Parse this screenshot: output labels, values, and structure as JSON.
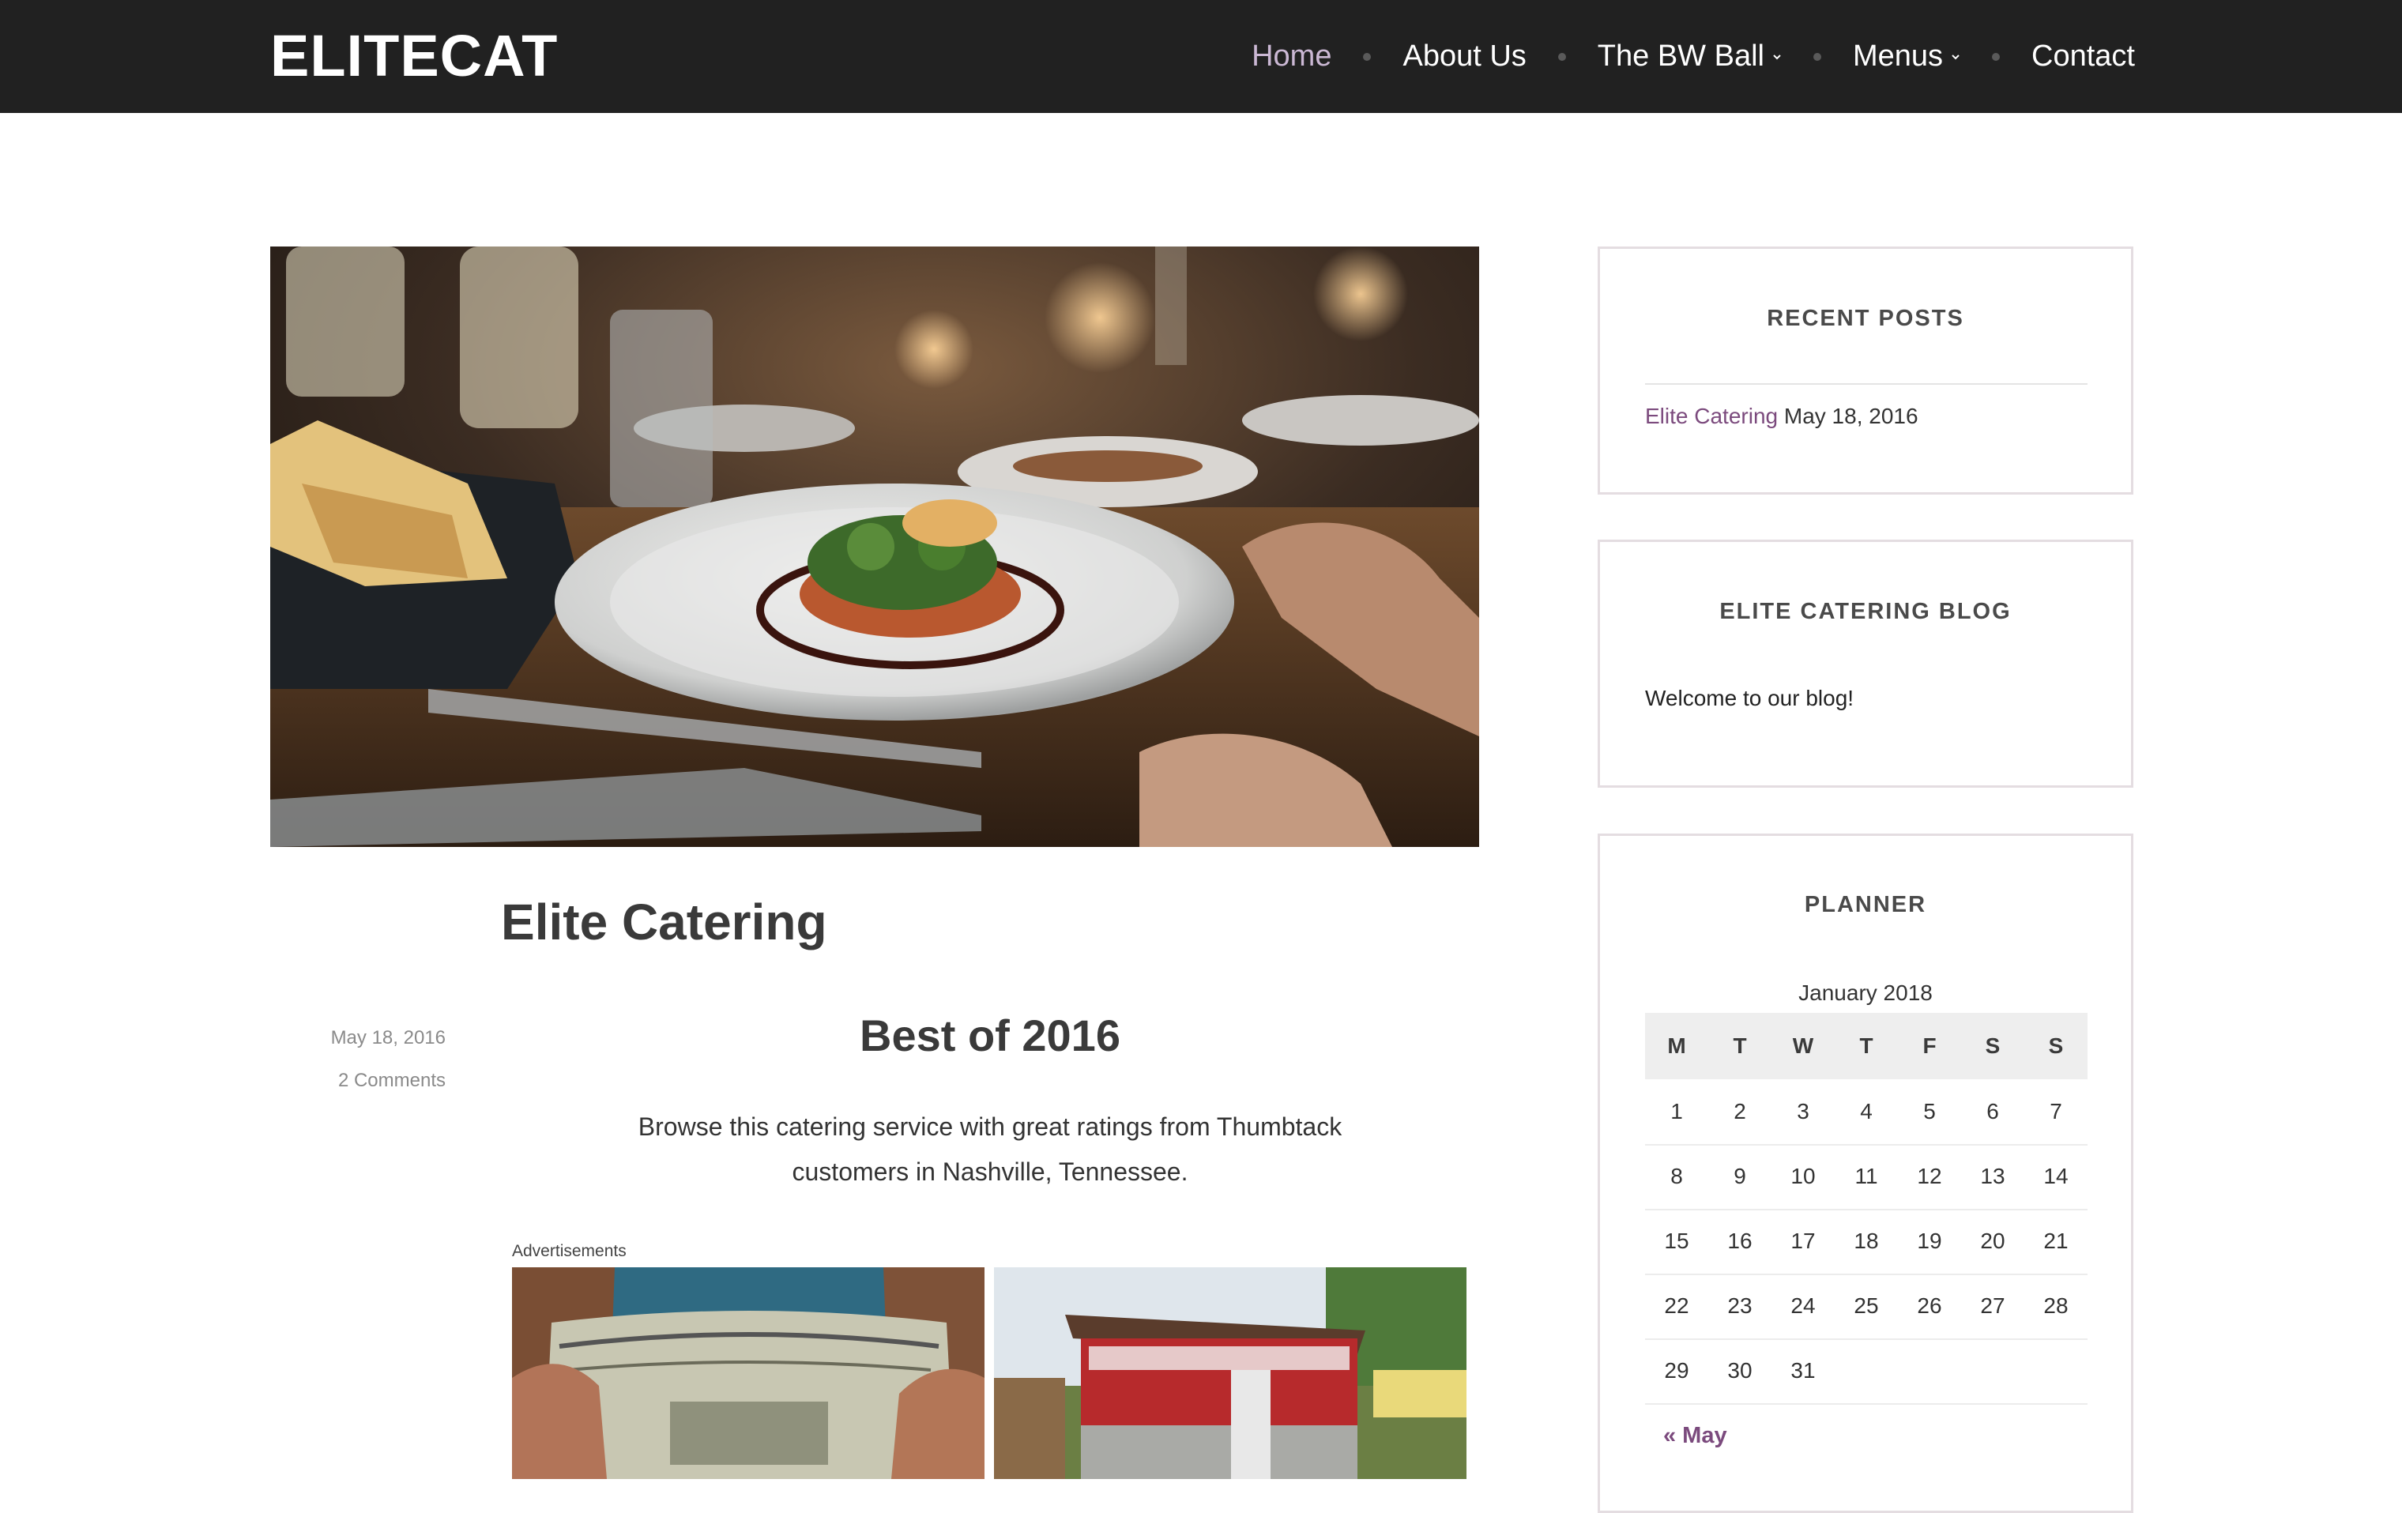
{
  "site": {
    "brand": "ELITECAT"
  },
  "nav": {
    "items": [
      {
        "label": "Home",
        "active": true,
        "dropdown": false
      },
      {
        "label": "About Us",
        "active": false,
        "dropdown": false
      },
      {
        "label": "The BW Ball",
        "active": false,
        "dropdown": true
      },
      {
        "label": "Menus",
        "active": false,
        "dropdown": true
      },
      {
        "label": "Contact",
        "active": false,
        "dropdown": false
      }
    ]
  },
  "post": {
    "title": "Elite Catering",
    "date": "May 18, 2016",
    "comments": "2 Comments",
    "heading": "Best of 2016",
    "body": "Browse this catering service with great ratings from Thumbtack customers in Nashville, Tennessee.",
    "ads_label": "Advertisements"
  },
  "sidebar": {
    "recent_posts": {
      "title": "RECENT POSTS",
      "link": "Elite Catering",
      "date": "May 18, 2016"
    },
    "blog": {
      "title": "ELITE CATERING BLOG",
      "text": "Welcome to our blog!"
    },
    "planner": {
      "title": "PLANNER",
      "caption": "January 2018",
      "weekdays": [
        "M",
        "T",
        "W",
        "T",
        "F",
        "S",
        "S"
      ],
      "weeks": [
        [
          "1",
          "2",
          "3",
          "4",
          "5",
          "6",
          "7"
        ],
        [
          "8",
          "9",
          "10",
          "11",
          "12",
          "13",
          "14"
        ],
        [
          "15",
          "16",
          "17",
          "18",
          "19",
          "20",
          "21"
        ],
        [
          "22",
          "23",
          "24",
          "25",
          "26",
          "27",
          "28"
        ],
        [
          "29",
          "30",
          "31",
          "",
          "",
          "",
          ""
        ]
      ],
      "prev": "« May"
    }
  },
  "colors": {
    "header_bg": "#212121",
    "nav_active": "#cbb8d4",
    "link": "#7b4a7d",
    "widget_border": "#e4dde1"
  }
}
